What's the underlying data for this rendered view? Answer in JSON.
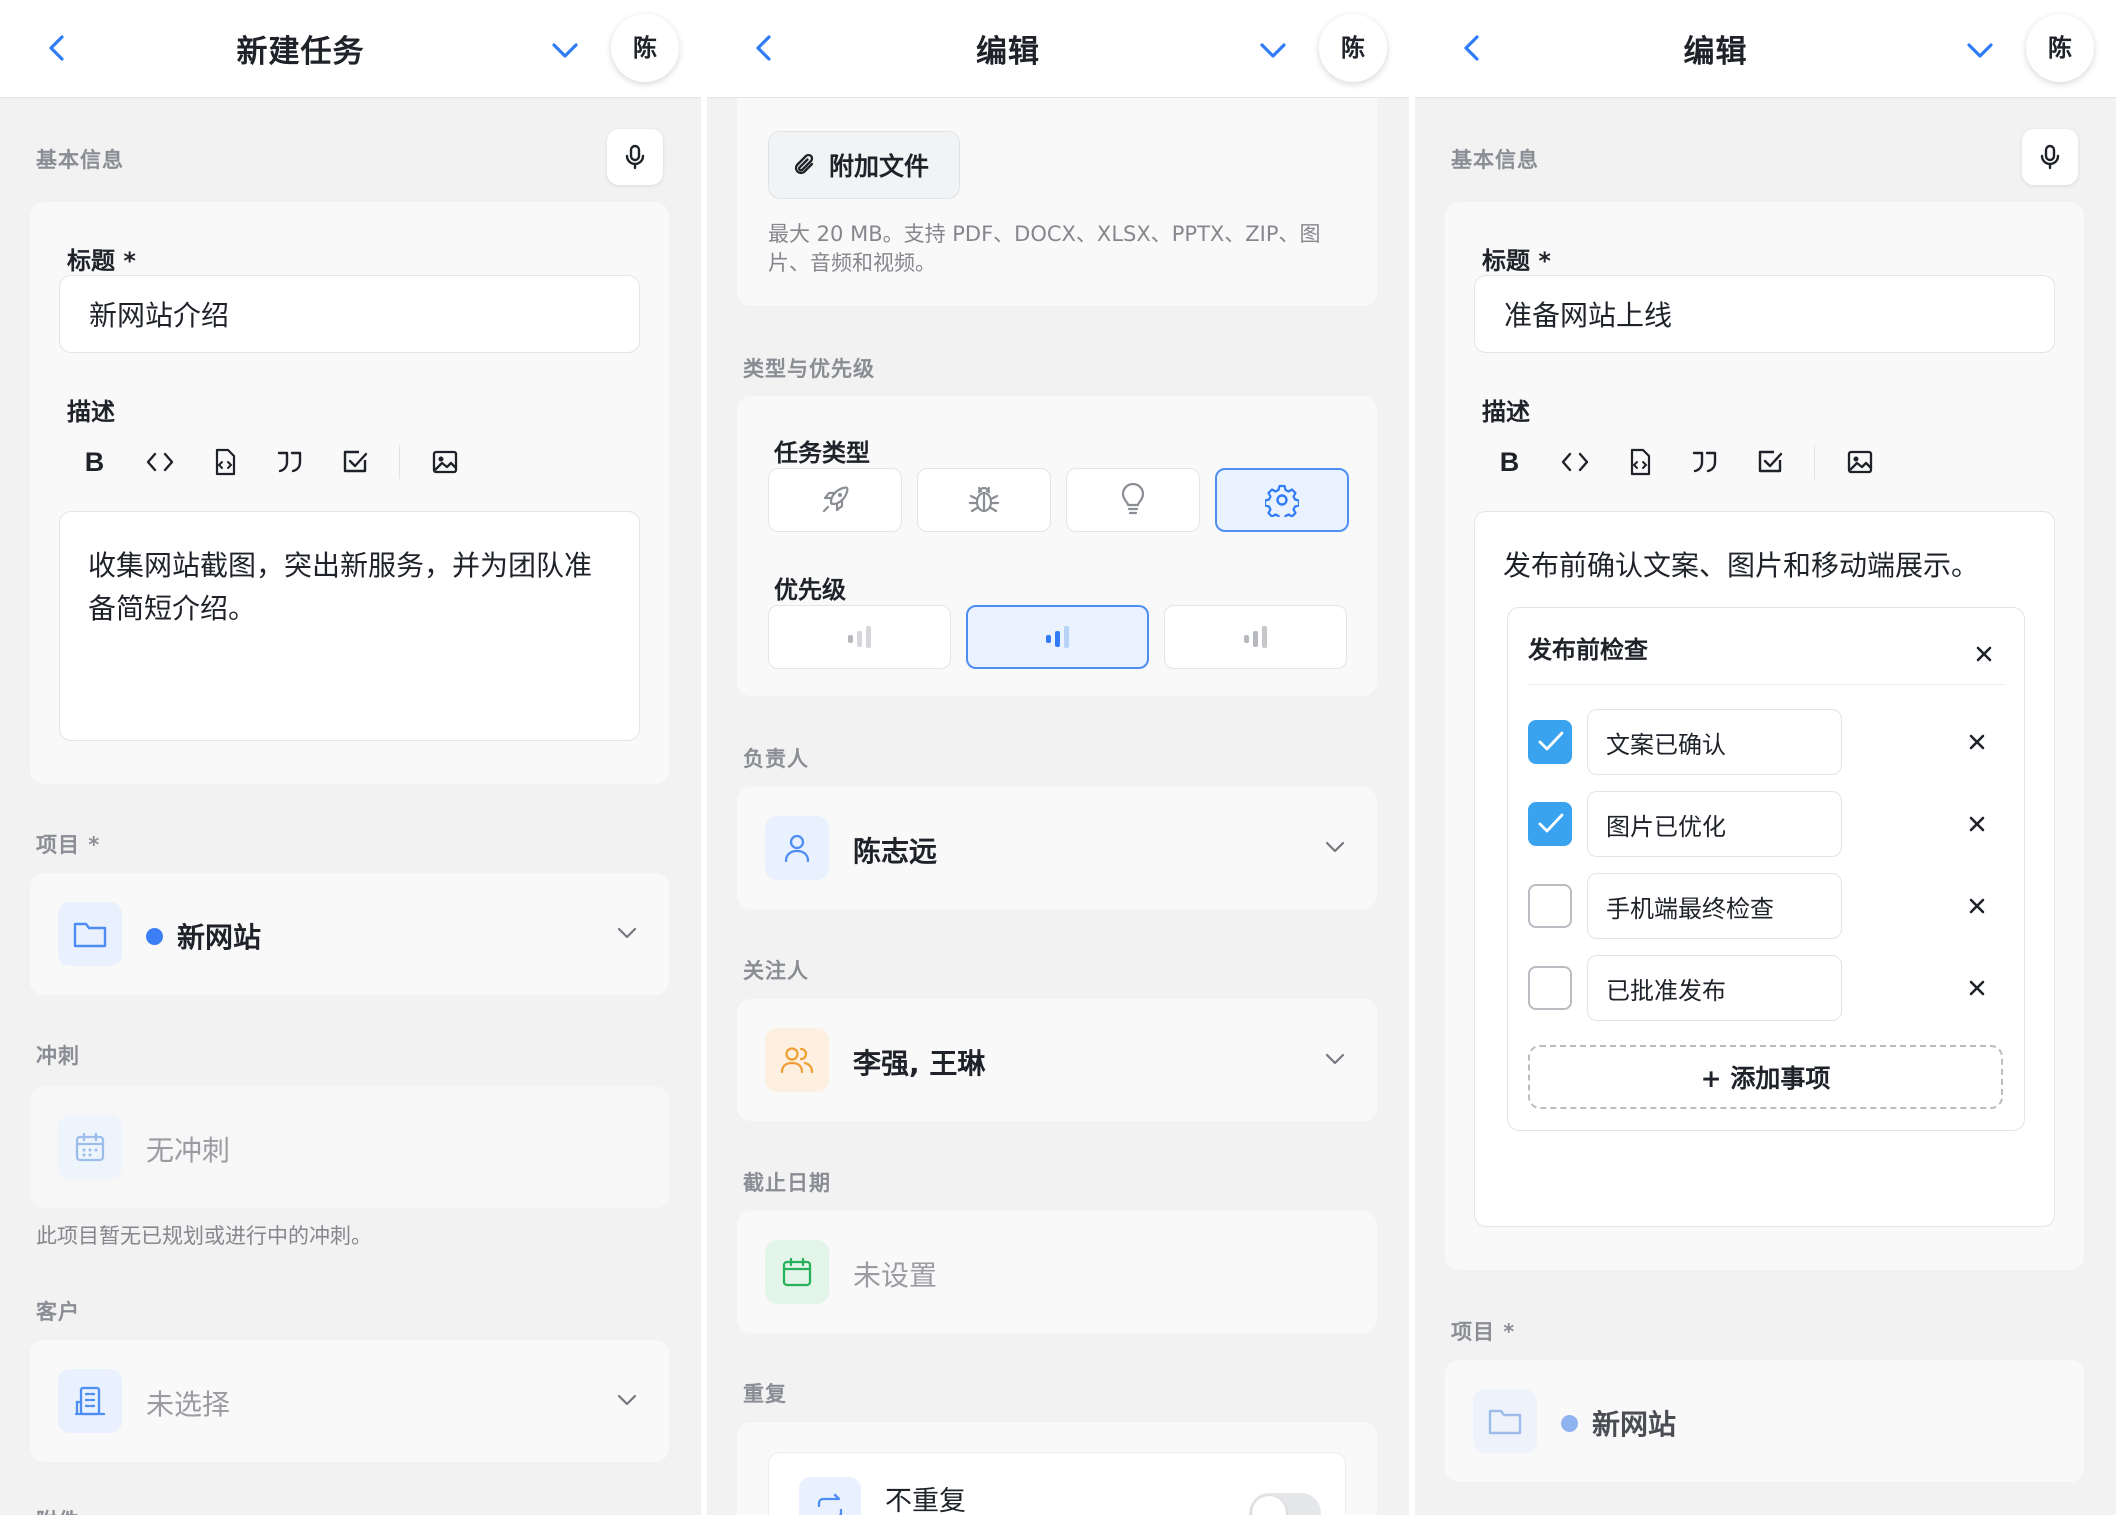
{
  "panel1": {
    "header": {
      "title": "新建任务",
      "avatar": "陈"
    },
    "basic_section": "基本信息",
    "title_label": "标题 *",
    "title_value": "新网站介绍",
    "desc_label": "描述",
    "toolbar": {
      "bold": "B"
    },
    "desc_value": "收集网站截图，突出新服务，并为团队准备简短介绍。",
    "project_section": "项目 *",
    "project_value": "新网站",
    "sprint_section": "冲刺",
    "sprint_value": "无冲刺",
    "sprint_hint": "此项目暂无已规划或进行中的冲刺。",
    "client_section": "客户",
    "client_value": "未选择",
    "next_section": "附件"
  },
  "panel2": {
    "header": {
      "title": "编辑",
      "avatar": "陈"
    },
    "attach_button": "附加文件",
    "attach_hint": "最大 20 MB。支持 PDF、DOCX、XLSX、PPTX、ZIP、图片、音频和视频。",
    "type_priority_section": "类型与优先级",
    "task_type_label": "任务类型",
    "task_types": [
      "rocket-icon",
      "bug-icon",
      "bulb-icon",
      "gear-icon"
    ],
    "task_type_selected": 3,
    "priority_label": "优先级",
    "priority_selected": 1,
    "assignee_section": "负责人",
    "assignee_value": "陈志远",
    "watchers_section": "关注人",
    "watchers_value": "李强, 王琳",
    "due_section": "截止日期",
    "due_value": "未设置",
    "repeat_section": "重复",
    "repeat_value": "不重复",
    "colors": {
      "accent": "#3c7ef5",
      "selected_bg": "#e9f2fe"
    }
  },
  "panel3": {
    "header": {
      "title": "编辑",
      "avatar": "陈"
    },
    "basic_section": "基本信息",
    "title_label": "标题 *",
    "title_value": "准备网站上线",
    "desc_label": "描述",
    "toolbar": {
      "bold": "B"
    },
    "desc_value": "发布前确认文案、图片和移动端展示。",
    "checklist": {
      "title": "发布前检查",
      "items": [
        {
          "text": "文案已确认",
          "checked": true
        },
        {
          "text": "图片已优化",
          "checked": true
        },
        {
          "text": "手机端最终检查",
          "checked": false
        },
        {
          "text": "已批准发布",
          "checked": false
        }
      ],
      "add_label": "+ 添加事项"
    },
    "project_section": "项目 *",
    "project_value": "新网站"
  }
}
